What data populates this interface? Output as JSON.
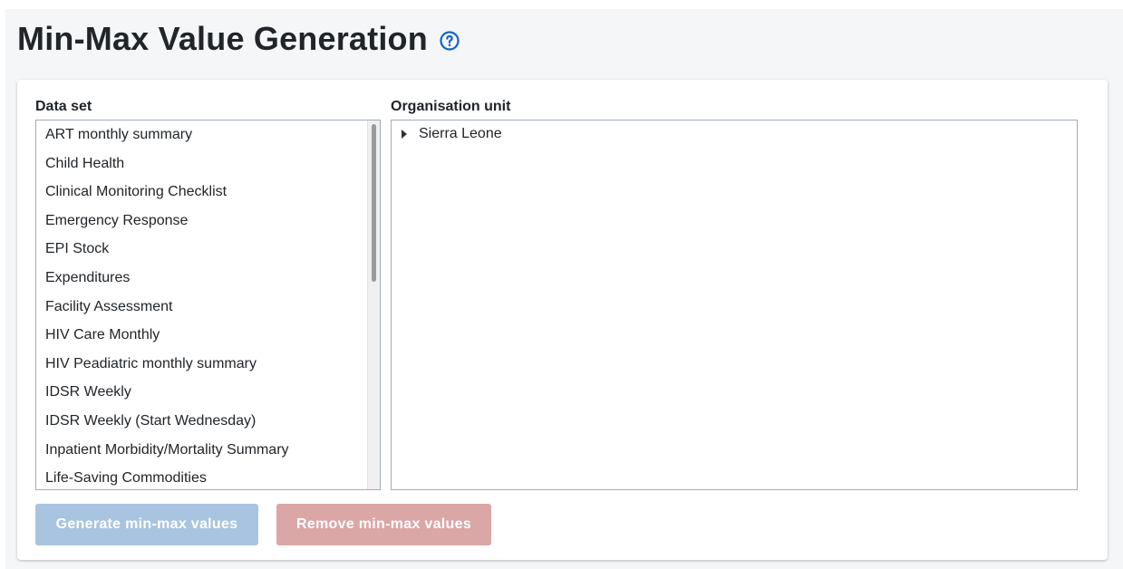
{
  "header": {
    "title": "Min-Max Value Generation"
  },
  "form": {
    "dataset_label": "Data set",
    "orgunit_label": "Organisation unit",
    "datasets": [
      "ART monthly summary",
      "Child Health",
      "Clinical Monitoring Checklist",
      "Emergency Response",
      "EPI Stock",
      "Expenditures",
      "Facility Assessment",
      "HIV Care Monthly",
      "HIV Peadiatric monthly summary",
      "IDSR Weekly",
      "IDSR Weekly (Start Wednesday)",
      "Inpatient Morbidity/Mortality Summary",
      "Life-Saving Commodities"
    ],
    "orgunit_root": "Sierra Leone"
  },
  "actions": {
    "generate_label": "Generate min-max values",
    "remove_label": "Remove min-max values"
  },
  "colors": {
    "help_icon": "#1565c0",
    "generate_button_disabled": "#a9c4e0",
    "remove_button_disabled": "#dba6a6"
  },
  "icons": {
    "help": "help-circle-icon",
    "tree_expand": "caret-right-icon"
  }
}
